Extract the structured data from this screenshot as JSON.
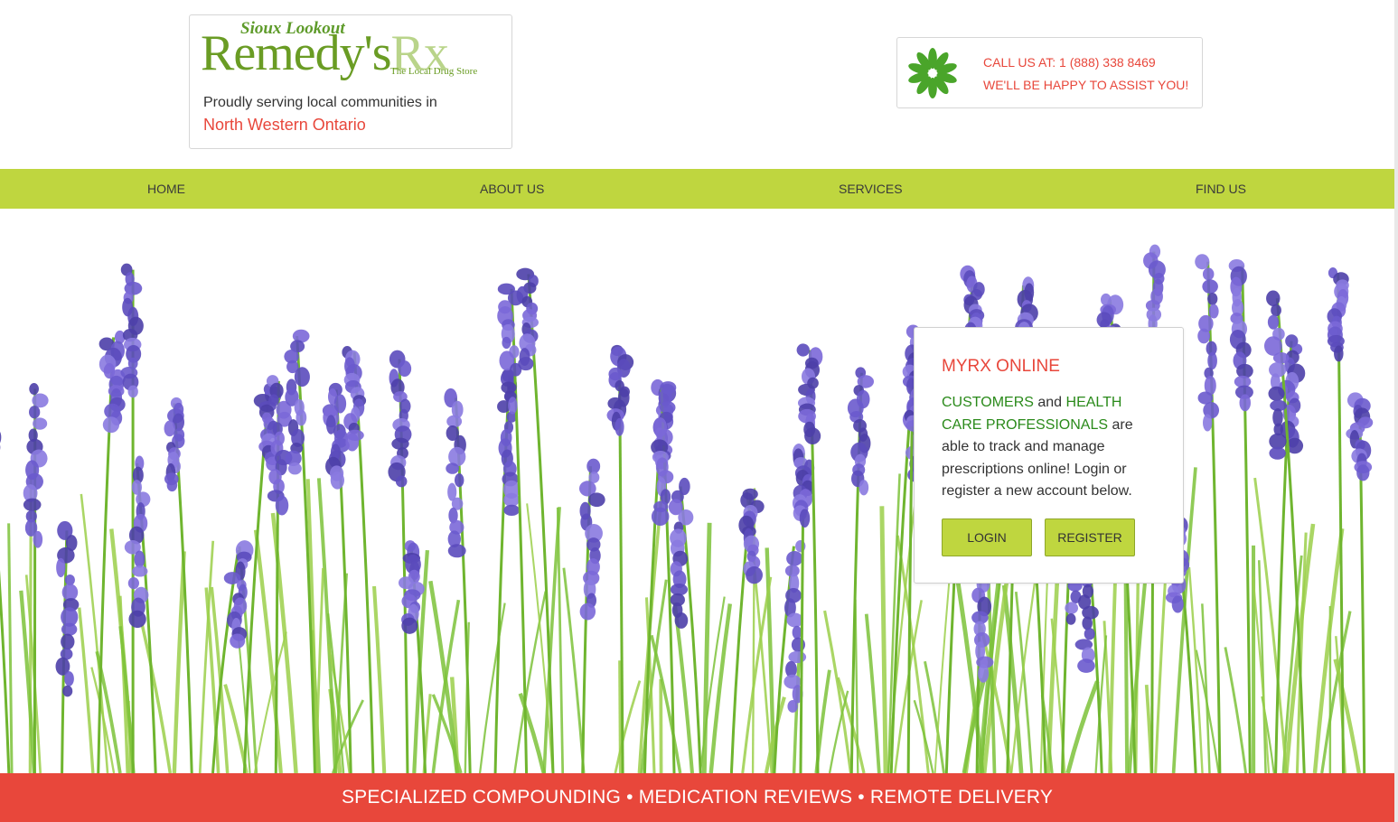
{
  "header": {
    "logo": {
      "tagline": "Sioux Lookout",
      "wordmark_main": "Remedy's",
      "wordmark_rx": "Rx",
      "subtitle": "The Local Drug Store"
    },
    "serving_text": "Proudly serving local communities in",
    "region_text": "North Western Ontario",
    "contact": {
      "icon": "flower-icon",
      "call_line": "CALL US AT: 1 (888) 338 8469",
      "assist_line": "WE'LL BE HAPPY TO ASSIST YOU!"
    }
  },
  "nav": {
    "items": [
      {
        "label": "HOME"
      },
      {
        "label": "ABOUT US"
      },
      {
        "label": "SERVICES"
      },
      {
        "label": "FIND US"
      }
    ]
  },
  "login_card": {
    "title": "MYRX ONLINE",
    "body": {
      "customers": "CUSTOMERS",
      "and": " and ",
      "professionals": "HEALTH CARE PROFESSIONALS",
      "rest": " are able to track and manage prescriptions online! Login or register a new account below."
    },
    "login_label": "LOGIN",
    "register_label": "REGISTER"
  },
  "banner": {
    "text": "SPECIALIZED COMPOUNDING • MEDICATION REVIEWS • REMOTE DELIVERY"
  },
  "colors": {
    "accent_green": "#bfd63f",
    "accent_red": "#e8473b",
    "text_green": "#2a8a1a",
    "lavender": "#6a5acd"
  }
}
